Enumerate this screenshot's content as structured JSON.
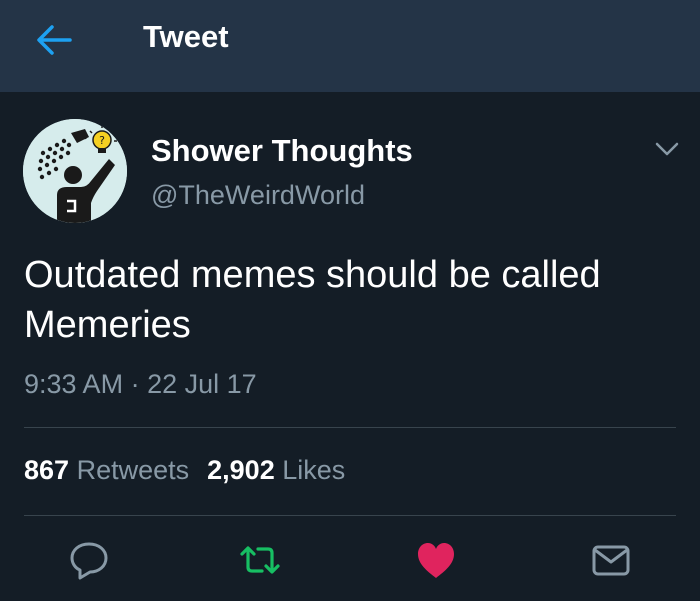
{
  "header": {
    "back_icon": "arrow-left-icon",
    "title": "Tweet"
  },
  "tweet": {
    "display_name": "Shower Thoughts",
    "handle": "@TheWeirdWorld",
    "text": "Outdated memes should be called Memeries",
    "time": "9:33 AM",
    "date_separator": "·",
    "date": "22 Jul 17",
    "retweet_count": "867",
    "retweet_label": "Retweets",
    "like_count": "2,902",
    "like_label": "Likes"
  },
  "actions": [
    {
      "name": "reply",
      "icon": "reply-icon"
    },
    {
      "name": "retweet",
      "icon": "retweet-icon"
    },
    {
      "name": "like",
      "icon": "heart-icon"
    },
    {
      "name": "direct-message",
      "icon": "envelope-icon"
    }
  ],
  "colors": {
    "header_bg": "#243447",
    "body_bg": "#141d26",
    "accent_blue": "#1da1f2",
    "retweet_green": "#17bf63",
    "like_red": "#e0245e",
    "muted_text": "#8899a6",
    "divider": "#38444d"
  }
}
